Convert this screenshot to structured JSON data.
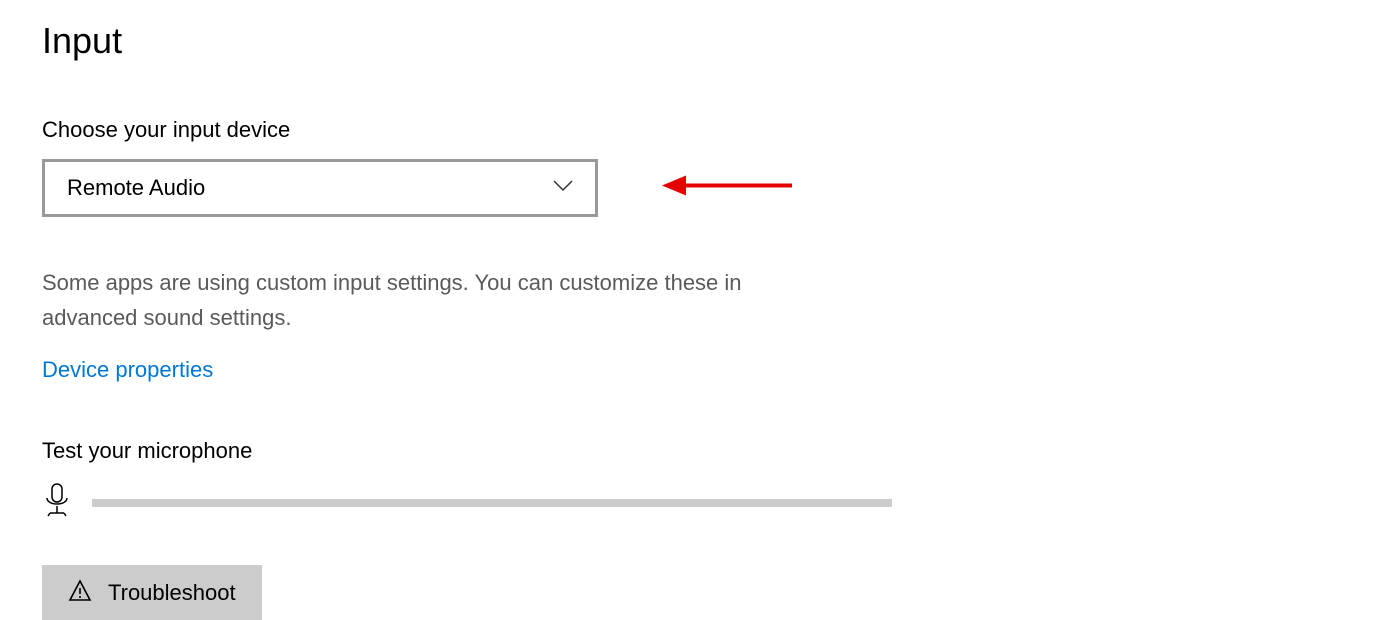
{
  "heading": "Input",
  "choose_label": "Choose your input device",
  "dropdown": {
    "selected": "Remote Audio"
  },
  "description": "Some apps are using custom input settings. You can customize these in advanced sound settings.",
  "link_device_properties": "Device properties",
  "test_label": "Test your microphone",
  "troubleshoot_label": "Troubleshoot"
}
